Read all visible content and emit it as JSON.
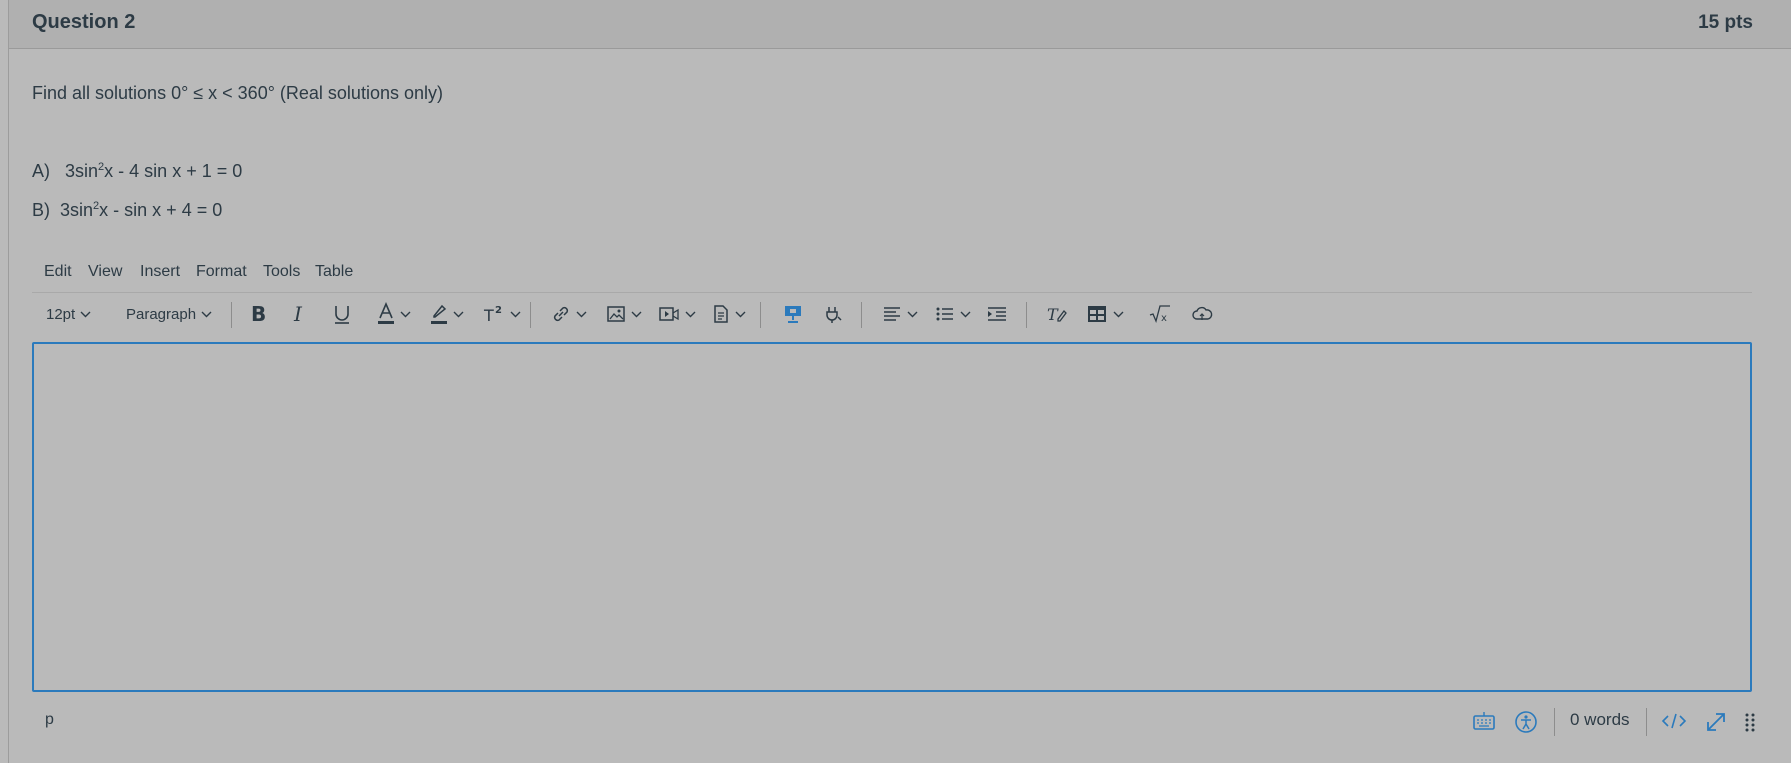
{
  "question": {
    "title": "Question 2",
    "points": "15 pts",
    "prompt": "Find all solutions 0° ≤ x < 360°  (Real solutions only)",
    "part_a": {
      "label": "A)",
      "pre": "3sin",
      "sup": "2",
      "post": "x - 4 sin x + 1 = 0"
    },
    "part_b": {
      "label": "B)",
      "pre": "3sin",
      "sup": "2",
      "post": "x -  sin x + 4 = 0"
    }
  },
  "menubar": {
    "edit": "Edit",
    "view": "View",
    "insert": "Insert",
    "format": "Format",
    "tools": "Tools",
    "table": "Table"
  },
  "toolbar": {
    "font_size": "12pt",
    "block_format": "Paragraph"
  },
  "statusbar": {
    "path": "p",
    "word_count": "0 words"
  },
  "colors": {
    "accent": "#2b7abc",
    "text": "#2d3b45",
    "background": "#bababa"
  }
}
